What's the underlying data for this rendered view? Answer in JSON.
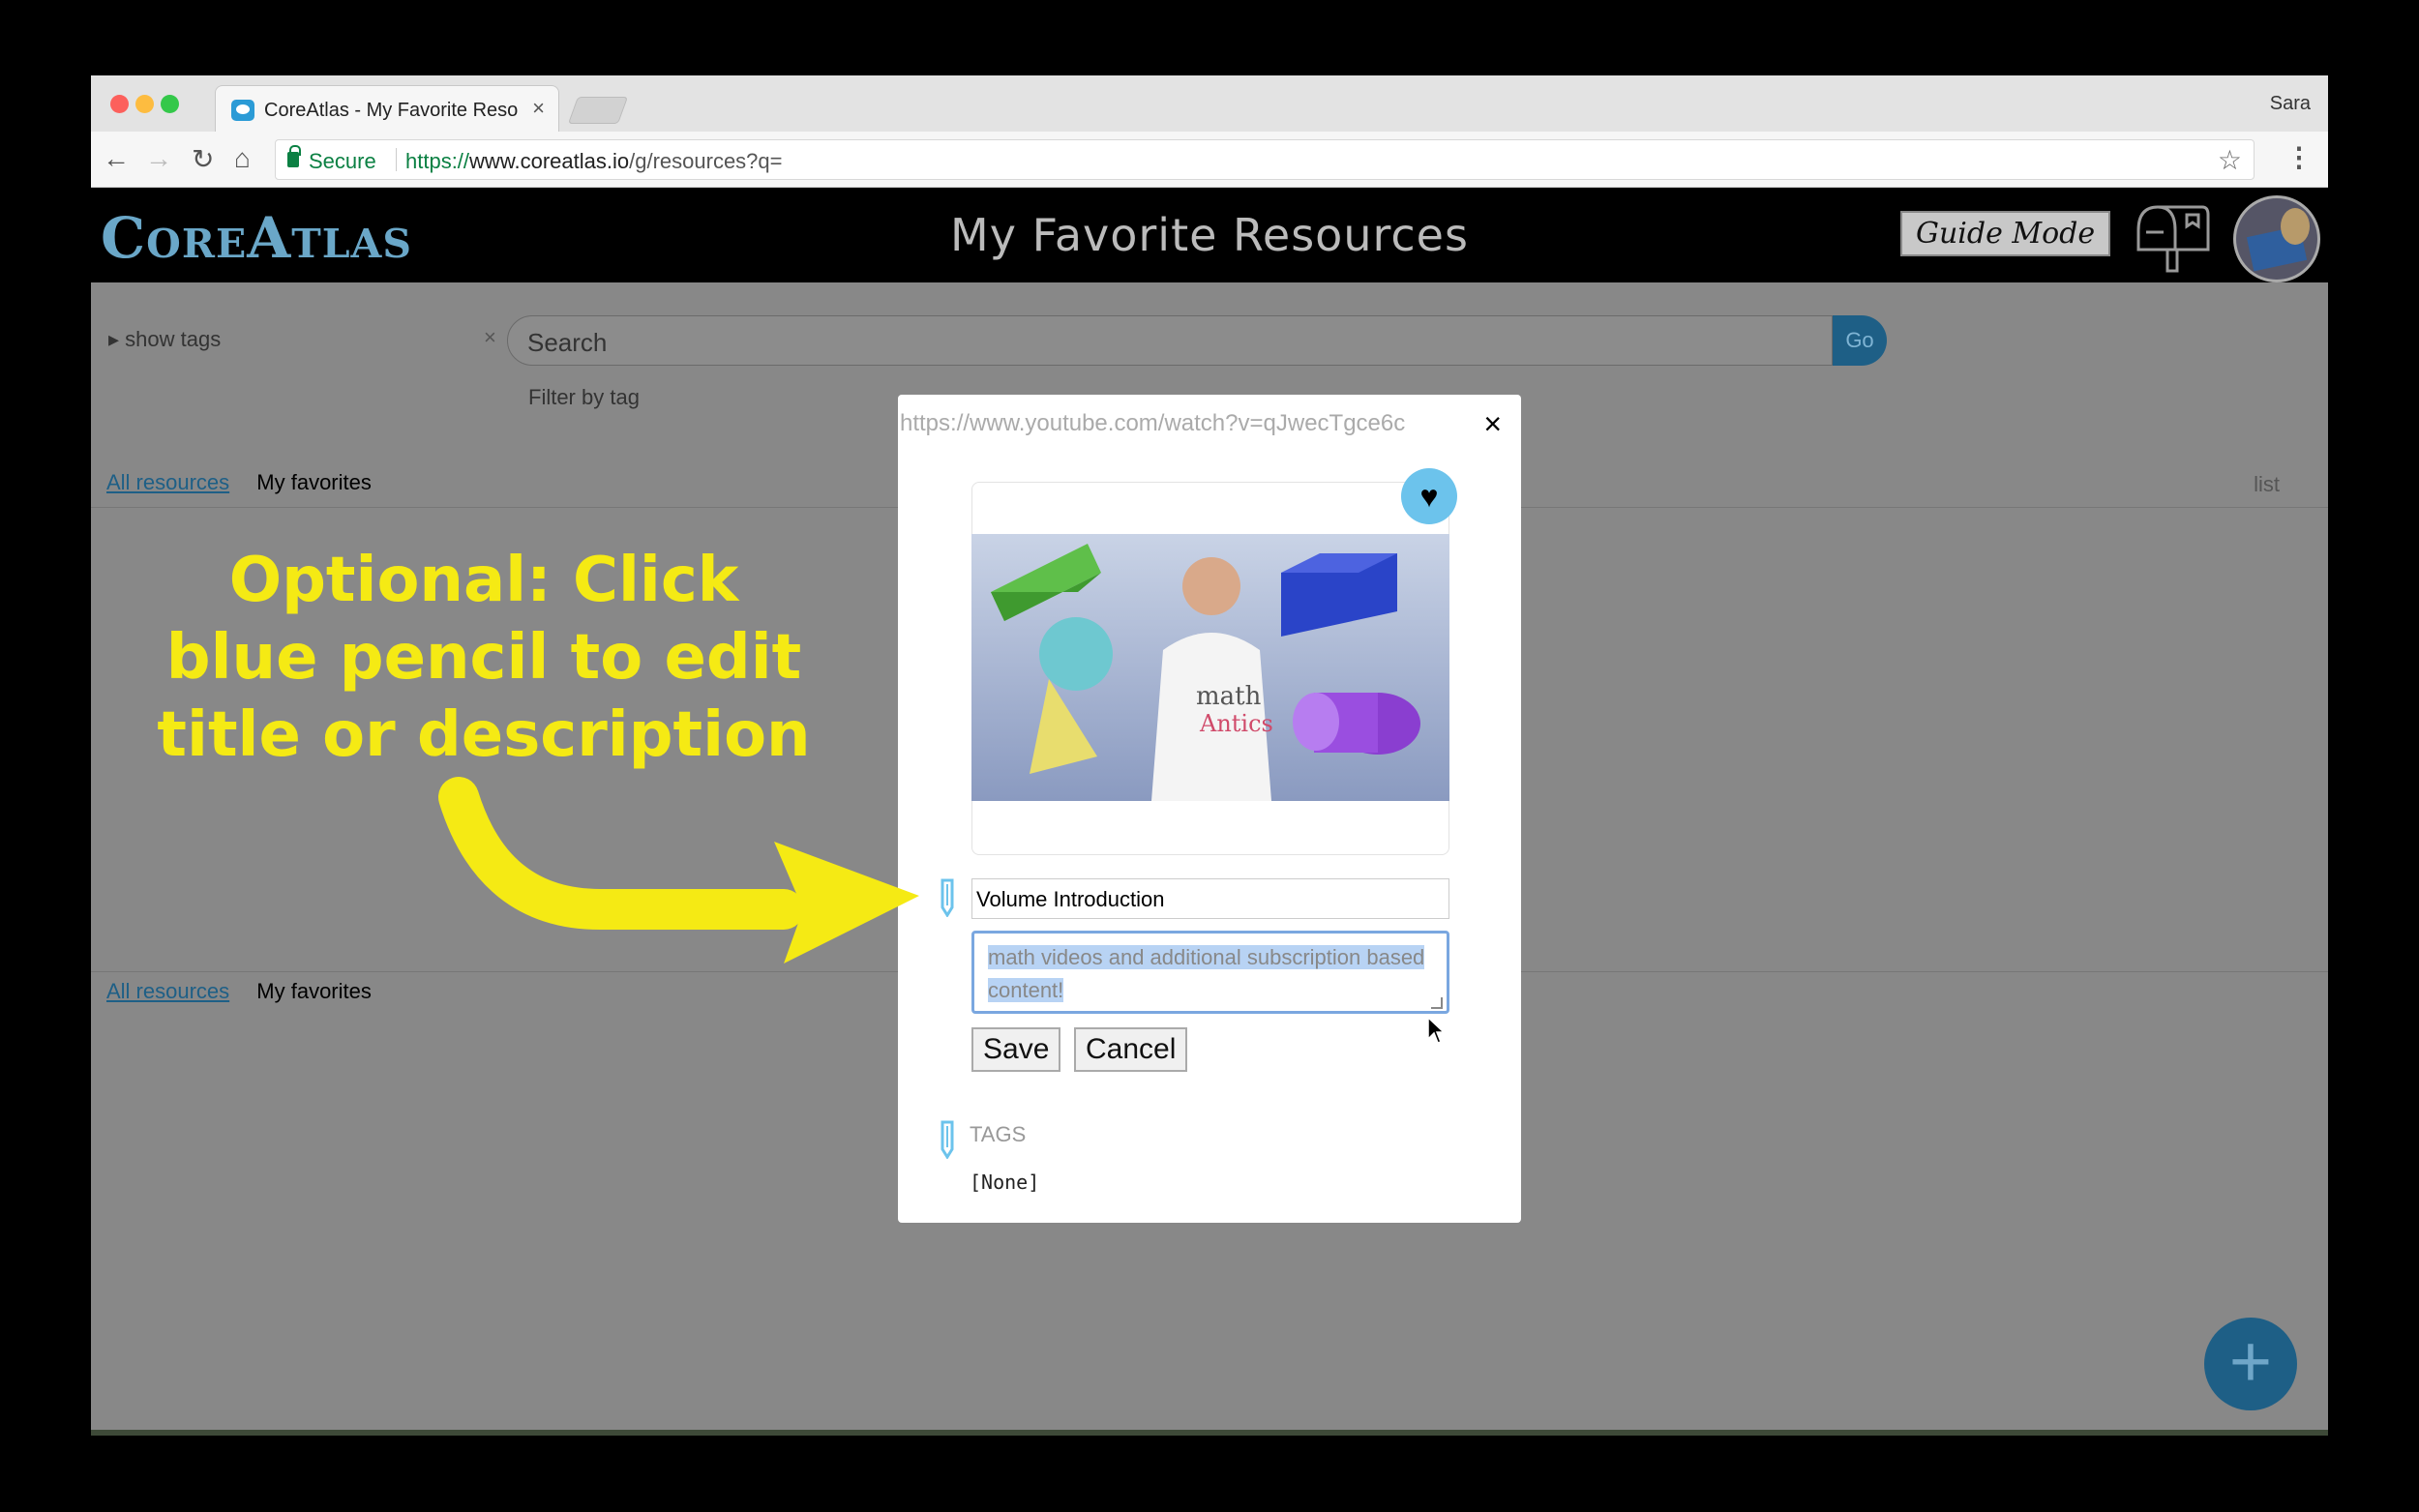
{
  "browser": {
    "tab_title": "CoreAtlas - My Favorite Resources",
    "tab_close": "×",
    "profile_name": "Sara",
    "secure_label": "Secure",
    "url_scheme": "https://",
    "url_host": "www.coreatlas.io",
    "url_path": "/g/resources?q="
  },
  "app": {
    "logo": "CoreAtlas",
    "page_title": "My Favorite Resources",
    "guide_mode_label": "Guide Mode"
  },
  "filters": {
    "show_tags": "show tags",
    "search_placeholder": "Search",
    "go_label": "Go",
    "filter_by_tag": "Filter by tag",
    "all_resources": "All resources",
    "my_favorites": "My favorites",
    "list_view": "list"
  },
  "modal": {
    "url": "https://www.youtube.com/watch?v=qJwecTgce6c",
    "close": "×",
    "title_value": "Volume Introduction",
    "description_value": "math videos and additional subscription based content!",
    "save_label": "Save",
    "cancel_label": "Cancel",
    "tags_heading": "TAGS",
    "tags_value": "[None]"
  },
  "annotation": {
    "line1": "Optional: Click",
    "line2": "blue pencil to edit",
    "line3": "title or description"
  },
  "icons": {
    "favorite": "heart-icon",
    "edit": "pencil-icon",
    "add": "plus-icon"
  },
  "colors": {
    "accent": "#1e5f86",
    "favorite_bg": "#6cc3ec",
    "annotation": "#f5ea14",
    "secure": "#0b8043"
  }
}
